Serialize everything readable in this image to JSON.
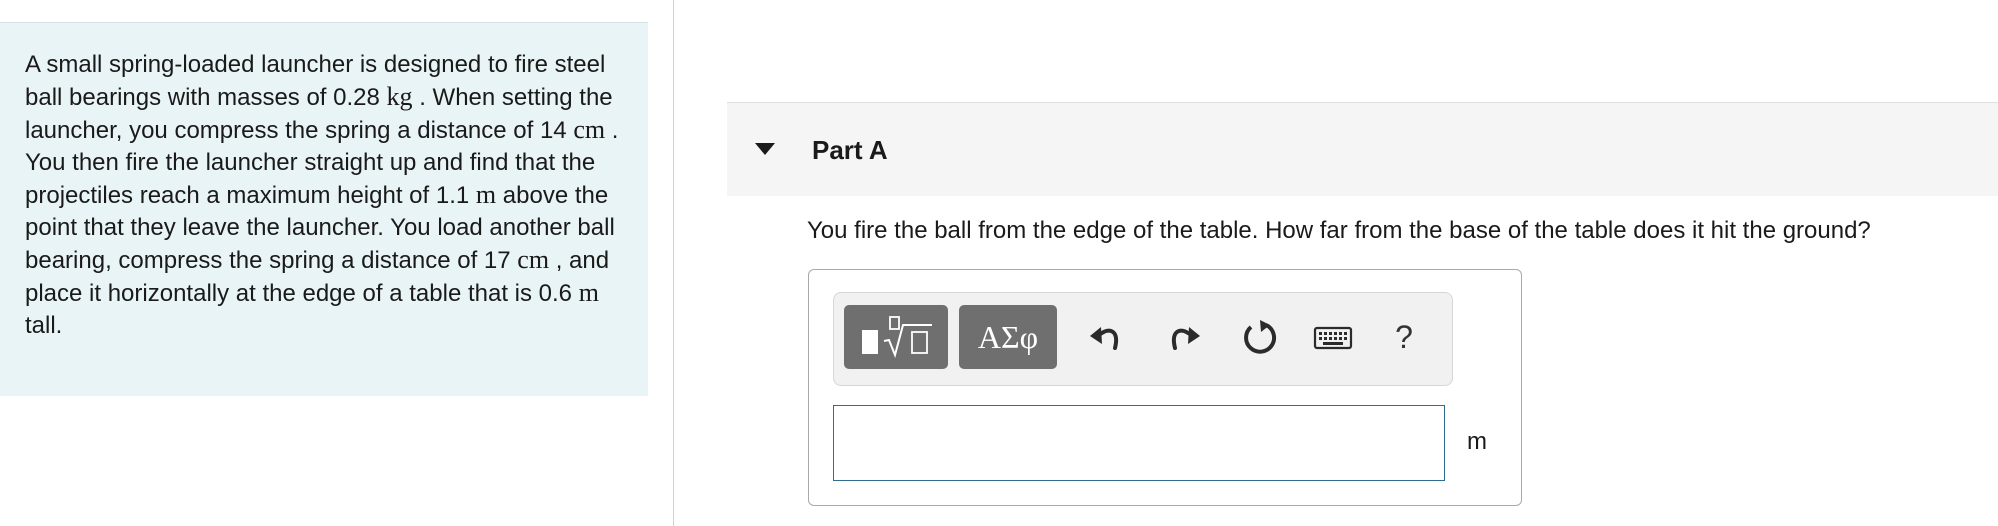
{
  "problem": {
    "segments": [
      {
        "text": "A small spring-loaded launcher is designed to fire steel ball bearings with masses of 0.28 ",
        "math": false
      },
      {
        "text": "kg",
        "math": true
      },
      {
        "text": " .  When setting the launcher, you compress the spring a distance of 14 ",
        "math": false
      },
      {
        "text": "cm",
        "math": true
      },
      {
        "text": " .  You then fire the launcher straight up and find that the projectiles reach a maximum height of 1.1 ",
        "math": false
      },
      {
        "text": "m",
        "math": true
      },
      {
        "text": " above the point that they leave the launcher.  You load another ball bearing, compress the spring a distance of 17 ",
        "math": false
      },
      {
        "text": "cm",
        "math": true
      },
      {
        "text": " , and place it horizontally at the edge of a table that is 0.6 ",
        "math": false
      },
      {
        "text": "m",
        "math": true
      },
      {
        "text": " tall.",
        "math": false
      }
    ]
  },
  "part": {
    "title": "Part A",
    "question": "You fire the ball from the edge of the table.  How far from the base of the table does it hit the ground?"
  },
  "answer": {
    "toolbar": {
      "templates_icon": "templates-sqrt-icon",
      "symbols_label": "ΑΣφ",
      "undo_icon": "undo-icon",
      "redo_icon": "redo-icon",
      "reset_icon": "reset-icon",
      "keyboard_icon": "keyboard-icon",
      "help_label": "?"
    },
    "input_value": "",
    "unit": "m"
  },
  "colors": {
    "problem_background": "#e9f4f6",
    "part_header_background": "#f5f5f5",
    "toolbar_button": "#6f6f6f",
    "input_border": "#2f6e8f"
  }
}
